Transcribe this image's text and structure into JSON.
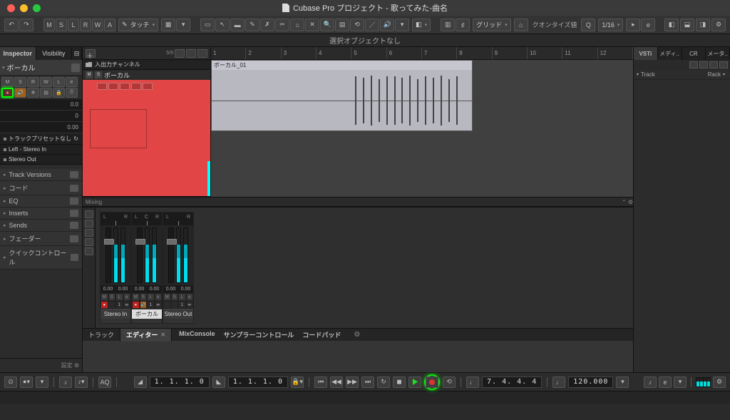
{
  "title": "Cubase Pro プロジェクト - 歌ってみた-曲名",
  "toolbar": {
    "msrwa": [
      "M",
      "S",
      "L",
      "R",
      "W",
      "A"
    ],
    "automation_mode": "タッチ",
    "snap_label": "グリッド",
    "quantize_label": "クオンタイズ値",
    "quantize_value": "1/16"
  },
  "infobar": "選択オブジェクトなし",
  "inspector": {
    "tabs": [
      "Inspector",
      "Visibility"
    ],
    "track_name": "ボーカル",
    "values": {
      "val1": "0.0",
      "val2": "0",
      "val3": "0.00"
    },
    "routing_preset": "トラックプリセットなし",
    "routing_in": "Left - Stereo In",
    "routing_out": "Stereo Out",
    "sections": [
      "Track Versions",
      "コード",
      "EQ",
      "Inserts",
      "Sends",
      "フェーダー",
      "クイックコントロール"
    ],
    "footer": "設定"
  },
  "track_list": {
    "io_label": "入出力チャンネル",
    "track_name": "ボーカル",
    "ruler_progress": "5/9"
  },
  "timeline": {
    "bars": [
      "1",
      "2",
      "3",
      "4",
      "5",
      "6",
      "7",
      "8",
      "9",
      "10",
      "11",
      "12"
    ],
    "clip_name": "ボーカル_01"
  },
  "divider": "Mixing",
  "channels": [
    {
      "pan": [
        "L",
        "R"
      ],
      "val": "0.00",
      "peak": "0.00",
      "rec_num": "1",
      "name": "Stereo In",
      "rec": true,
      "name_dark": true
    },
    {
      "pan": [
        "L",
        "C",
        "R"
      ],
      "val": "0.00",
      "peak": "0.00",
      "rec_num": "1",
      "name": "ボーカル",
      "rec": true
    },
    {
      "pan": [
        "L",
        "R"
      ],
      "val": "0.00",
      "peak": "0.00",
      "rec_num": "1",
      "name": "Stereo Out",
      "name_dark": true
    }
  ],
  "lower_tabs": {
    "left": [
      "トラック",
      "エディター"
    ],
    "right": [
      "MixConsole",
      "サンプラーコントロール",
      "コードパッド"
    ]
  },
  "right_panel": {
    "tabs": [
      "VSTi",
      "メディ..",
      "CR",
      "メータ.."
    ],
    "track_label": "Track",
    "rack_label": "Rack"
  },
  "transport": {
    "aq": "AQ",
    "primary_time": "1. 1. 1.   0",
    "secondary_time": "1. 1. 1.   0",
    "bars_beats": "7.  4.  4.   4",
    "tempo": "120.000"
  }
}
